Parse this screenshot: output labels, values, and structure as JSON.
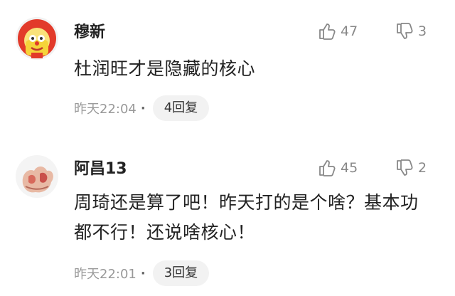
{
  "comments": [
    {
      "username": "穆新",
      "avatar_icon": "cartoon-clown-avatar",
      "likes": "47",
      "dislikes": "3",
      "content": "杜润旺才是隐藏的核心",
      "time": "昨天22:04",
      "dot": "·",
      "replies": "4回复"
    },
    {
      "username": "阿昌13",
      "avatar_icon": "pink-hands-avatar",
      "likes": "45",
      "dislikes": "2",
      "content": "周琦还是算了吧！昨天打的是个啥？基本功都不行！还说啥核心！",
      "time": "昨天22:01",
      "dot": "·",
      "replies": "3回复"
    }
  ],
  "colors": {
    "text": "#222222",
    "muted": "#999999",
    "icon": "#888888",
    "pill_bg": "#f2f2f2"
  }
}
